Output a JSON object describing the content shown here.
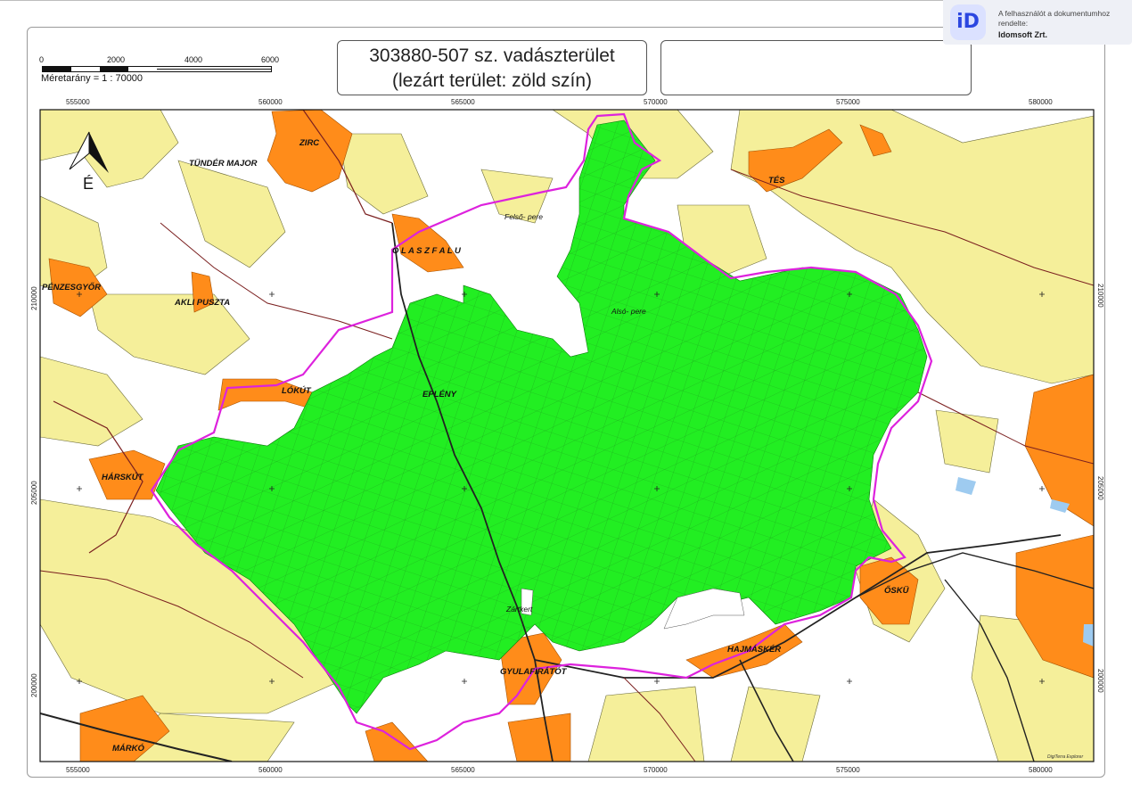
{
  "title": {
    "line1": "303880-507 sz. vadászterület",
    "line2": "(lezárt terület: zöld szín)"
  },
  "scale": {
    "ticks": [
      "0",
      "2000",
      "4000",
      "6000"
    ],
    "label": "Méretarány = 1 : 70000"
  },
  "watermark": {
    "logo_text": "iD",
    "text": "A felhasználót a dokumentumhoz rendelte:",
    "company": "Idomsoft Zrt."
  },
  "axes": {
    "x_top": [
      "555000",
      "560000",
      "565000",
      "570000",
      "575000",
      "580000"
    ],
    "x_bottom": [
      "555000",
      "560000",
      "565000",
      "570000",
      "575000",
      "580000"
    ],
    "y_left": [
      "210000",
      "205000",
      "200000"
    ],
    "y_right": [
      "210000",
      "205000",
      "200000"
    ]
  },
  "north_label": "É",
  "places": {
    "zirc": "ZIRC",
    "tunder_major": "TÜNDÉR MAJOR",
    "tes": "TÉS",
    "felso_pere": "Felső- pere",
    "olaszfalu": "O L A S Z F A L U",
    "penzesgyor": "PÉNZESGYŐR",
    "akli_puszta": "AKLI PUSZTA",
    "also_pere": "Alsó- pere",
    "lokut": "LÓKÚT",
    "eplenyi": "EPLÉNY",
    "harskut": "HÁRSKÚT",
    "osku": "ŐSKÜ",
    "zartkert": "Zártkert",
    "hajmasker": "HAJMÁSKÉR",
    "gyulafiratot": "GYULAFIRÁTÓT",
    "marko": "MÁRKÓ"
  },
  "credit": "DigiTerra Explorer",
  "colors": {
    "hunting_area": "#22ee22",
    "boundary": "#dd22dd",
    "forest": "#f5ef9a",
    "settlement": "#ff8c1a",
    "water": "#9ecbf0"
  }
}
